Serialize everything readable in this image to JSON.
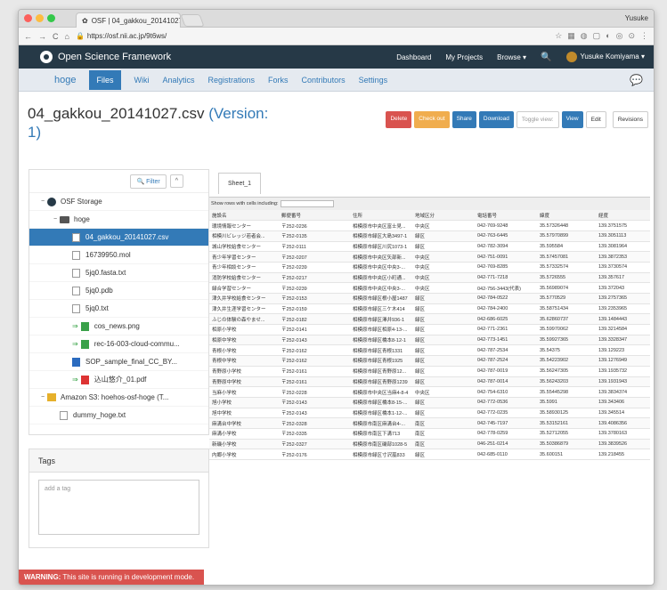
{
  "browser": {
    "tab_title": "OSF | 04_gakkou_20141027.c",
    "url": "https://osf.nii.ac.jp/9t6ws/",
    "user": "Yusuke"
  },
  "osf": {
    "brand": "Open Science Framework",
    "nav": [
      "Dashboard",
      "My Projects",
      "Browse ▾"
    ],
    "user": "Yusuke Komiyama ▾"
  },
  "project": {
    "title": "hoge",
    "tabs": [
      "Files",
      "Wiki",
      "Analytics",
      "Registrations",
      "Forks",
      "Contributors",
      "Settings"
    ]
  },
  "file": {
    "name": "04_gakkou_20141027.csv",
    "version": "(Version: 1)",
    "buttons": {
      "delete": "Delete",
      "checkout": "Check out",
      "share": "Share",
      "download": "Download",
      "toggle": "Toggle view:",
      "view": "View",
      "edit": "Edit",
      "revisions": "Revisions"
    }
  },
  "sidebar": {
    "filter": "Filter",
    "up": "^",
    "items": [
      {
        "label": "OSF Storage",
        "type": "gear",
        "indent": 0,
        "toggle": "−"
      },
      {
        "label": "hoge",
        "type": "folder",
        "indent": 1,
        "toggle": "−"
      },
      {
        "label": "04_gakkou_20141027.csv",
        "type": "file",
        "indent": 2,
        "selected": true
      },
      {
        "label": "16739950.mol",
        "type": "file",
        "indent": 2
      },
      {
        "label": "5jq0.fasta.txt",
        "type": "file",
        "indent": 2
      },
      {
        "label": "5jq0.pdb",
        "type": "file",
        "indent": 2
      },
      {
        "label": "5jq0.txt",
        "type": "file",
        "indent": 2
      },
      {
        "label": "cos_news.png",
        "type": "img",
        "indent": 2,
        "plus": true
      },
      {
        "label": "rec-16-003-cloud-commu...",
        "type": "img",
        "indent": 2,
        "plus": true
      },
      {
        "label": "SOP_sample_final_CC_BY...",
        "type": "doc",
        "indent": 2
      },
      {
        "label": "込山悠介_01.pdf",
        "type": "pdf",
        "indent": 2,
        "plus": true
      },
      {
        "label": "Amazon S3: hoehos-osf-hoge (T...",
        "type": "s3",
        "indent": 0,
        "toggle": "−"
      },
      {
        "label": "dummy_hoge.txt",
        "type": "file",
        "indent": 1
      }
    ]
  },
  "tags": {
    "title": "Tags",
    "placeholder": "add a tag"
  },
  "sheet": {
    "tab": "Sheet_1",
    "show_rows_label": "Show rows with cells including:",
    "columns": [
      "施設名",
      "郵便番号",
      "住所",
      "地域区分",
      "電話番号",
      "緯度",
      "経度"
    ],
    "rows": [
      [
        "環境情報センター",
        "〒252-0236",
        "相模原市中央区富士見...",
        "中央区",
        "042-769-9248",
        "35.57326448",
        "139.3751575"
      ],
      [
        "相模川ビレッジ若者会...",
        "〒252-0135",
        "相模原市緑区大島3497-1",
        "緑区",
        "042-763-6445",
        "35.57970899",
        "139.3051113"
      ],
      [
        "城山学校給食センター",
        "〒252-0111",
        "相模原市緑区川尻1073-1",
        "緑区",
        "042-782-3094",
        "35.595584",
        "139.3081964"
      ],
      [
        "青少年学習センター",
        "〒252-0207",
        "相模原市中央区矢部新...",
        "中央区",
        "042-751-0091",
        "35.57457081",
        "139.3872353"
      ],
      [
        "青少年相談センター",
        "〒252-0239",
        "相模原市中央区中央3-...",
        "中央区",
        "042-769-8285",
        "35.57332574",
        "139.3730574"
      ],
      [
        "消防学校給食センター",
        "〒252-0217",
        "相模原市中央区小町通...",
        "中央区",
        "042-771-7218",
        "35.5726555",
        "139.357617"
      ],
      [
        "緑合学習センター",
        "〒252-0239",
        "相模原市中央区中央3-...",
        "中央区",
        "042-756-3443(代表)",
        "35.56989074",
        "139.372043"
      ],
      [
        "津久井学校給食センター",
        "〒252-0153",
        "相模原市緑区根小屋1487",
        "緑区",
        "042-784-0522",
        "35.5770529",
        "139.2757365"
      ],
      [
        "津久井生涯学習センター",
        "〒252-0159",
        "相模原市緑区三ケ木414",
        "緑区",
        "042-784-2400",
        "35.58751434",
        "139.2353965"
      ],
      [
        "ふじの体験の森やませ...",
        "〒252-0182",
        "相模原市緑区澤井936-1",
        "緑区",
        "042-686-6025",
        "35.62860737",
        "139.1484443"
      ],
      [
        "相原小学校",
        "〒252-0141",
        "相模原市緑区相原4-13-...",
        "緑区",
        "042-771-2361",
        "35.59970062",
        "139.3214584"
      ],
      [
        "相原中学校",
        "〒252-0143",
        "相模原市緑区橋本8-12-1",
        "緑区",
        "042-773-1451",
        "35.59927365",
        "139.3328347"
      ],
      [
        "青根小学校",
        "〒252-0162",
        "相模原市緑区青根1331",
        "緑区",
        "042-787-2534",
        "35.54375",
        "139.129223"
      ],
      [
        "青根中学校",
        "〒252-0162",
        "相模原市緑区青根1925",
        "緑区",
        "042-787-2524",
        "35.54223902",
        "139.1276949"
      ],
      [
        "青野原小学校",
        "〒252-0161",
        "相模原市緑区青野原12...",
        "緑区",
        "042-787-0019",
        "35.56247305",
        "139.1935732"
      ],
      [
        "青野原中学校",
        "〒252-0161",
        "相模原市緑区青野原1239",
        "緑区",
        "042-787-0014",
        "35.56243203",
        "139.1931943"
      ],
      [
        "当麻小学校",
        "〒252-0228",
        "相模原市中央区当麻4-8-4",
        "中央区",
        "042-754-6310",
        "35.55445298",
        "139.3834374"
      ],
      [
        "旭小学校",
        "〒252-0143",
        "相模原市緑区橋本8-15-...",
        "緑区",
        "042-772-0536",
        "35.5991",
        "139.343406"
      ],
      [
        "旭中学校",
        "〒252-0143",
        "相模原市緑区橋本1-12-...",
        "緑区",
        "042-772-0235",
        "35.58930125",
        "139.345514"
      ],
      [
        "麻溝台中学校",
        "〒252-0328",
        "相模原市南区麻溝台4-...",
        "南区",
        "042-745-7197",
        "35.53152161",
        "139.4086356"
      ],
      [
        "麻溝小学校",
        "〒252-0335",
        "相模原市南区下溝713",
        "南区",
        "042-778-0259",
        "35.52712055",
        "139.3780163"
      ],
      [
        "新磯小学校",
        "〒252-0327",
        "相模原市南区磯部1028-5",
        "南区",
        "046-251-0214",
        "35.50386879",
        "139.3839526"
      ],
      [
        "内郷小学校",
        "〒252-0176",
        "相模原市緑区寸沢嵐833",
        "緑区",
        "042-685-0110",
        "35.600151",
        "139.218455"
      ]
    ]
  },
  "warning": {
    "strong": "WARNING:",
    "text": " This site is running in development mode."
  },
  "colors": {
    "nav_bg": "#263947",
    "primary": "#337ab7",
    "danger": "#d9534f",
    "warning": "#f0ad4e"
  }
}
